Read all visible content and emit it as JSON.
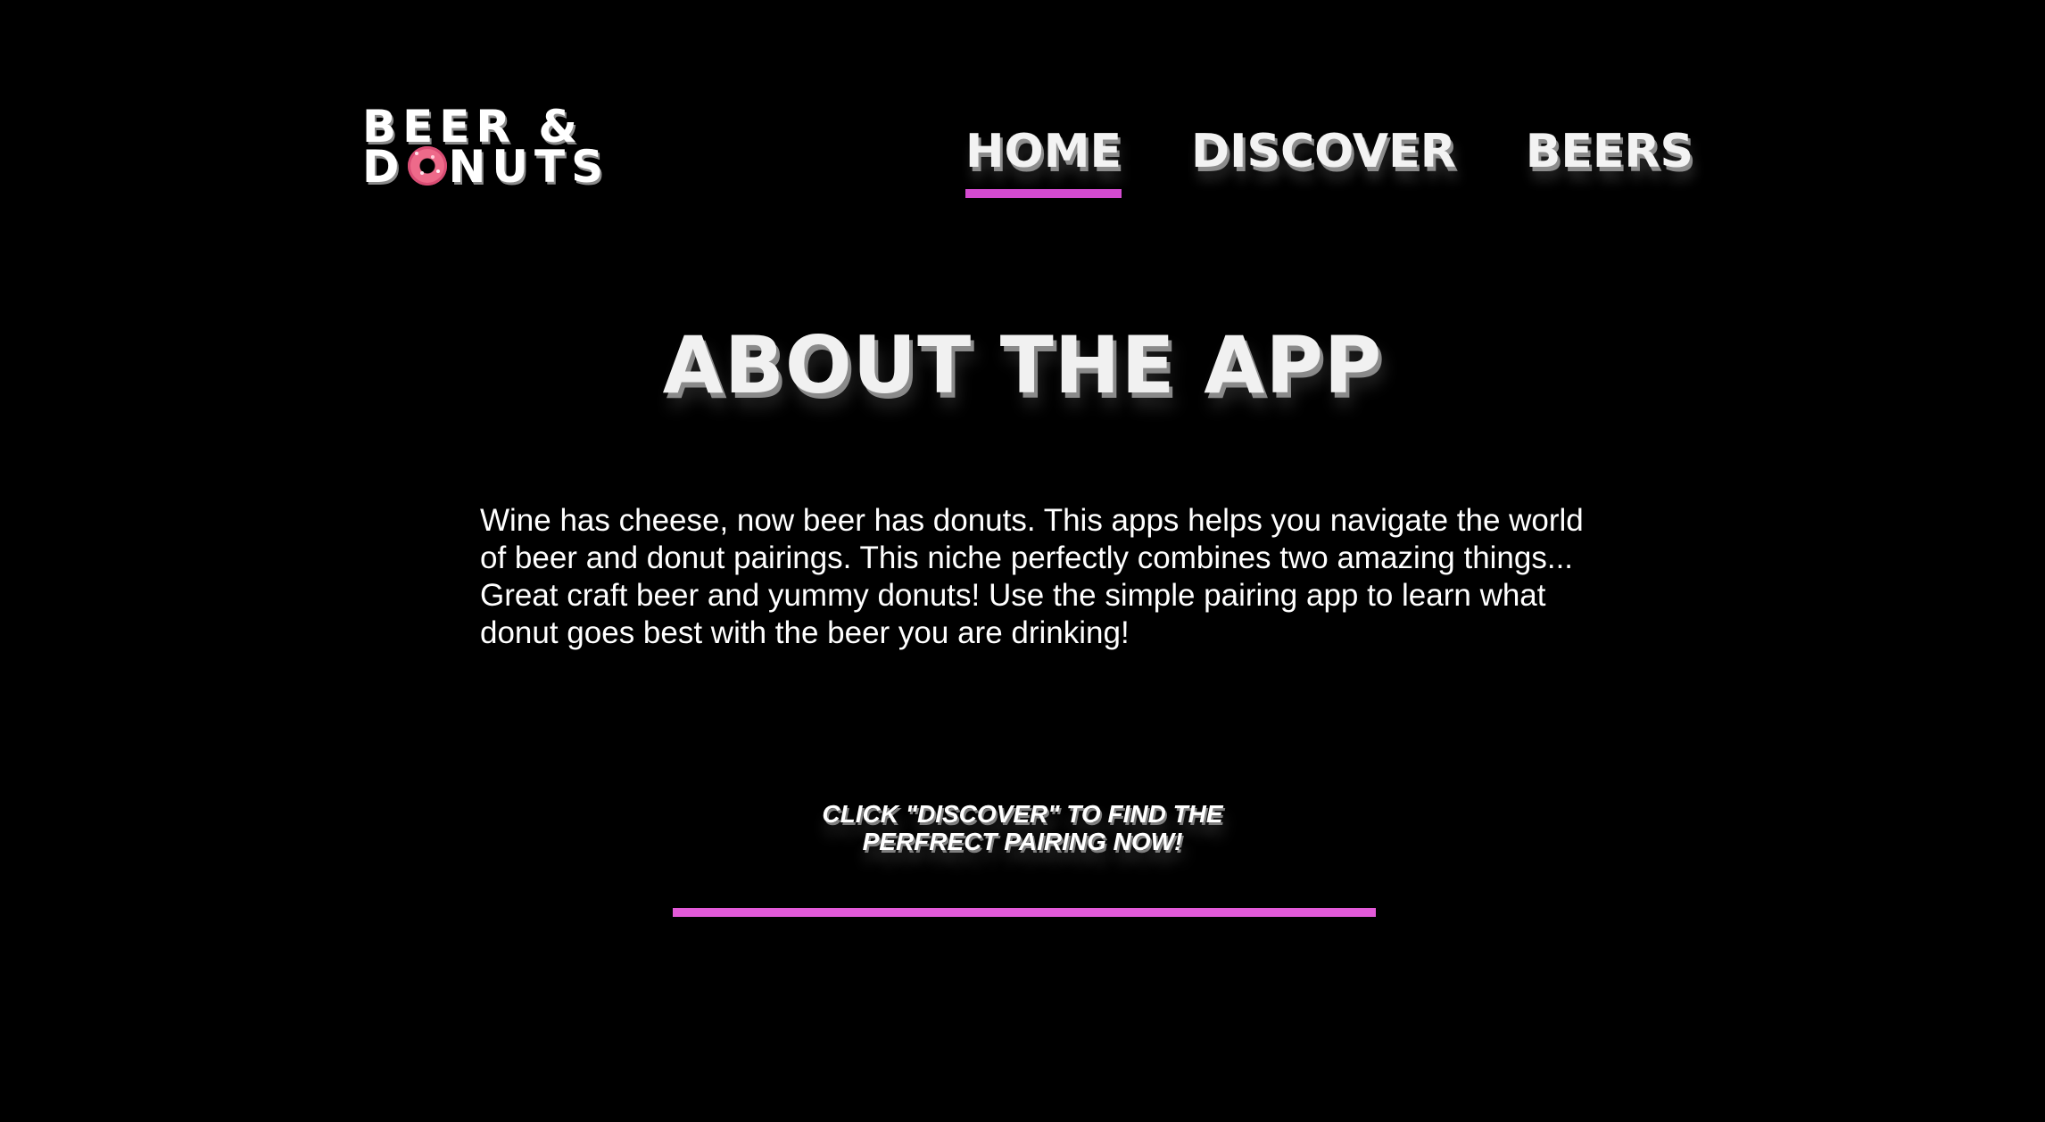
{
  "brand": {
    "logo_line1": "BEER &",
    "logo_line2_pre": "D",
    "logo_line2_post": "NUTS",
    "logo_icon": "donut-icon"
  },
  "nav": {
    "items": [
      {
        "label": "HOME",
        "active": true
      },
      {
        "label": "DISCOVER",
        "active": false
      },
      {
        "label": "BEERS",
        "active": false
      }
    ]
  },
  "main": {
    "title": "ABOUT THE APP",
    "description": "Wine has cheese, now beer has donuts. This apps helps you navigate the world of beer and donut pairings. This niche perfectly combines two amazing things... Great craft beer and yummy donuts! Use the simple pairing app to learn what donut goes best with the beer you are drinking!",
    "cta_line1": "CLICK \"DISCOVER\" TO FIND THE",
    "cta_line2": "PERFRECT PAIRING NOW!"
  },
  "colors": {
    "background": "#000000",
    "accent": "#e35ad9",
    "text": "#ffffff"
  }
}
